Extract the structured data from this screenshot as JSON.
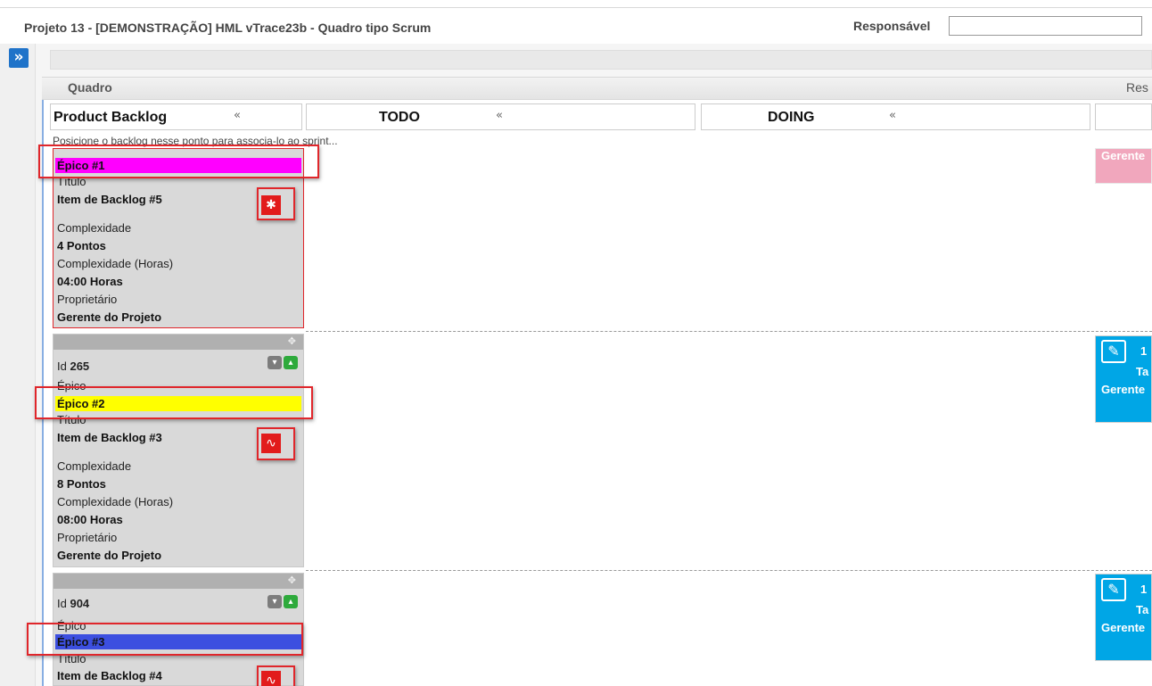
{
  "header": {
    "title": "Projeto 13 - [DEMONSTRAÇÃO] HML vTrace23b - Quadro tipo Scrum",
    "responsavel_label": "Responsável",
    "responsavel_value": ""
  },
  "left_panel": {
    "expand_icon": "double-chevron-right-icon",
    "expand_glyph": "»"
  },
  "section": {
    "title": "Quadro",
    "right_label": "Res"
  },
  "columns": [
    {
      "name": "Product Backlog",
      "collapse": "«"
    },
    {
      "name": "TODO",
      "collapse": "«"
    },
    {
      "name": "DOING",
      "collapse": "«"
    },
    {
      "name": "",
      "collapse": ""
    }
  ],
  "backlog_hint": "Posicione o backlog nesse ponto para associa-lo ao sprint...",
  "labels": {
    "id": "Id",
    "epico": "Épico",
    "titulo": "Título",
    "complexidade": "Complexidade",
    "complexidade_horas": "Complexidade (Horas)",
    "proprietario": "Proprietário"
  },
  "cards": [
    {
      "id": "",
      "epic": "Épico #1",
      "epic_color": "#ff00ff",
      "title": "Item de Backlog #5",
      "type_icon": "bug-icon",
      "type_glyph": "✱",
      "points": "4 Pontos",
      "hours": "04:00 Horas",
      "owner": "Gerente do Projeto"
    },
    {
      "id": "265",
      "epic": "Épico #2",
      "epic_color": "#ffff00",
      "title": "Item de Backlog #3",
      "type_icon": "pulse-icon",
      "type_glyph": "∿",
      "points": "8 Pontos",
      "hours": "08:00 Horas",
      "owner": "Gerente do Projeto"
    },
    {
      "id": "904",
      "epic": "Épico #3",
      "epic_color": "#3c4fe0",
      "title": "Item de Backlog #4",
      "type_icon": "pulse-icon",
      "type_glyph": "∿"
    }
  ],
  "vote_icons": {
    "down": "thumbs-down-icon",
    "up": "thumbs-up-icon",
    "down_glyph": "▾",
    "up_glyph": "▴"
  },
  "right_cards": [
    {
      "owner": "Gerente",
      "color": "#f1a7bd"
    },
    {
      "icon": "edit-icon",
      "glyph": "✎",
      "num": "1",
      "line": "Ta",
      "owner": "Gerente",
      "color": "#00a6e6"
    },
    {
      "icon": "edit-icon",
      "glyph": "✎",
      "num": "1",
      "line": "Ta",
      "owner": "Gerente",
      "color": "#00a6e6"
    }
  ],
  "highlight_color": "#e0262b"
}
